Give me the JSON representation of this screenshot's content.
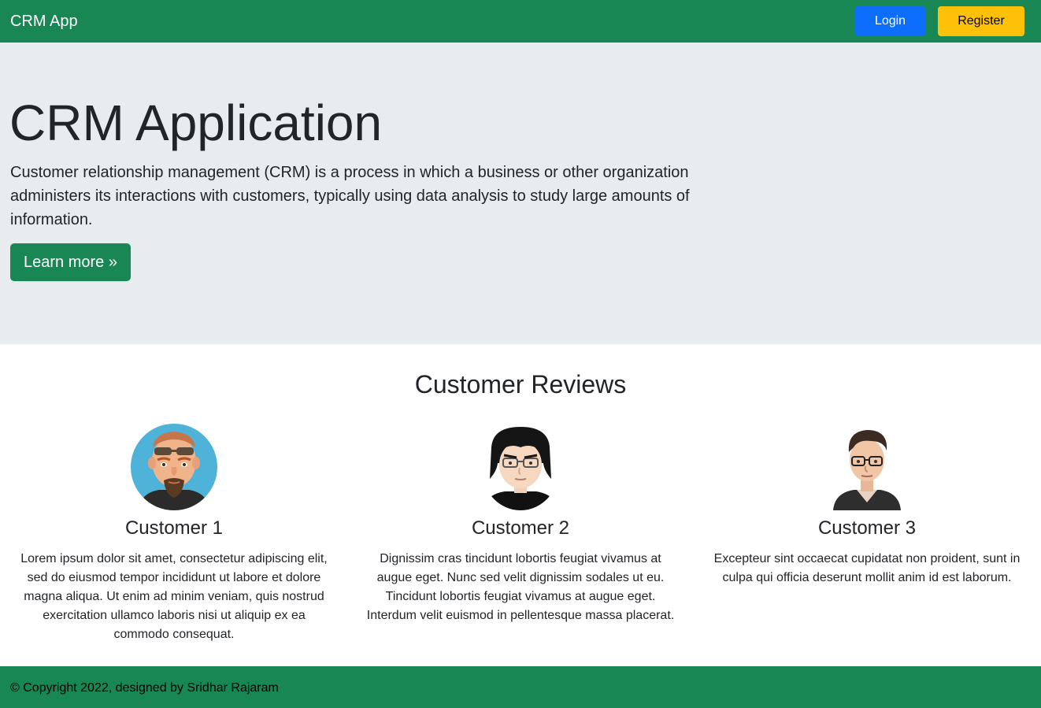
{
  "navbar": {
    "brand": "CRM App",
    "login_label": "Login",
    "register_label": "Register"
  },
  "hero": {
    "title": "CRM Application",
    "description": "Customer relationship management (CRM) is a process in which a business or other organization administers its interactions with customers, typically using data analysis to study large amounts of information.",
    "button_label": "Learn more »"
  },
  "reviews": {
    "heading": "Customer Reviews",
    "items": [
      {
        "name": "Customer 1",
        "text": "Lorem ipsum dolor sit amet, consectetur adipiscing elit, sed do eiusmod tempor incididunt ut labore et dolore magna aliqua. Ut enim ad minim veniam, quis nostrud exercitation ullamco laboris nisi ut aliquip ex ea commodo consequat.",
        "avatar": "man-sunglasses-goatee-avatar-icon"
      },
      {
        "name": "Customer 2",
        "text": "Dignissim cras tincidunt lobortis feugiat vivamus at augue eget. Nunc sed velit dignissim sodales ut eu. Tincidunt lobortis feugiat vivamus at augue eget. Interdum velit euismod in pellentesque massa placerat.",
        "avatar": "man-glasses-black-hair-avatar-icon"
      },
      {
        "name": "Customer 3",
        "text": "Excepteur sint occaecat cupidatat non proident, sunt in culpa qui officia deserunt mollit anim id est laborum.",
        "avatar": "man-glasses-jacket-avatar-icon"
      }
    ]
  },
  "footer": {
    "text": "© Copyright 2022, designed by Sridhar Rajaram"
  },
  "colors": {
    "primary_green": "#198754",
    "login_blue": "#0d6efd",
    "register_yellow": "#ffc107",
    "hero_bg": "#e9ecef"
  }
}
